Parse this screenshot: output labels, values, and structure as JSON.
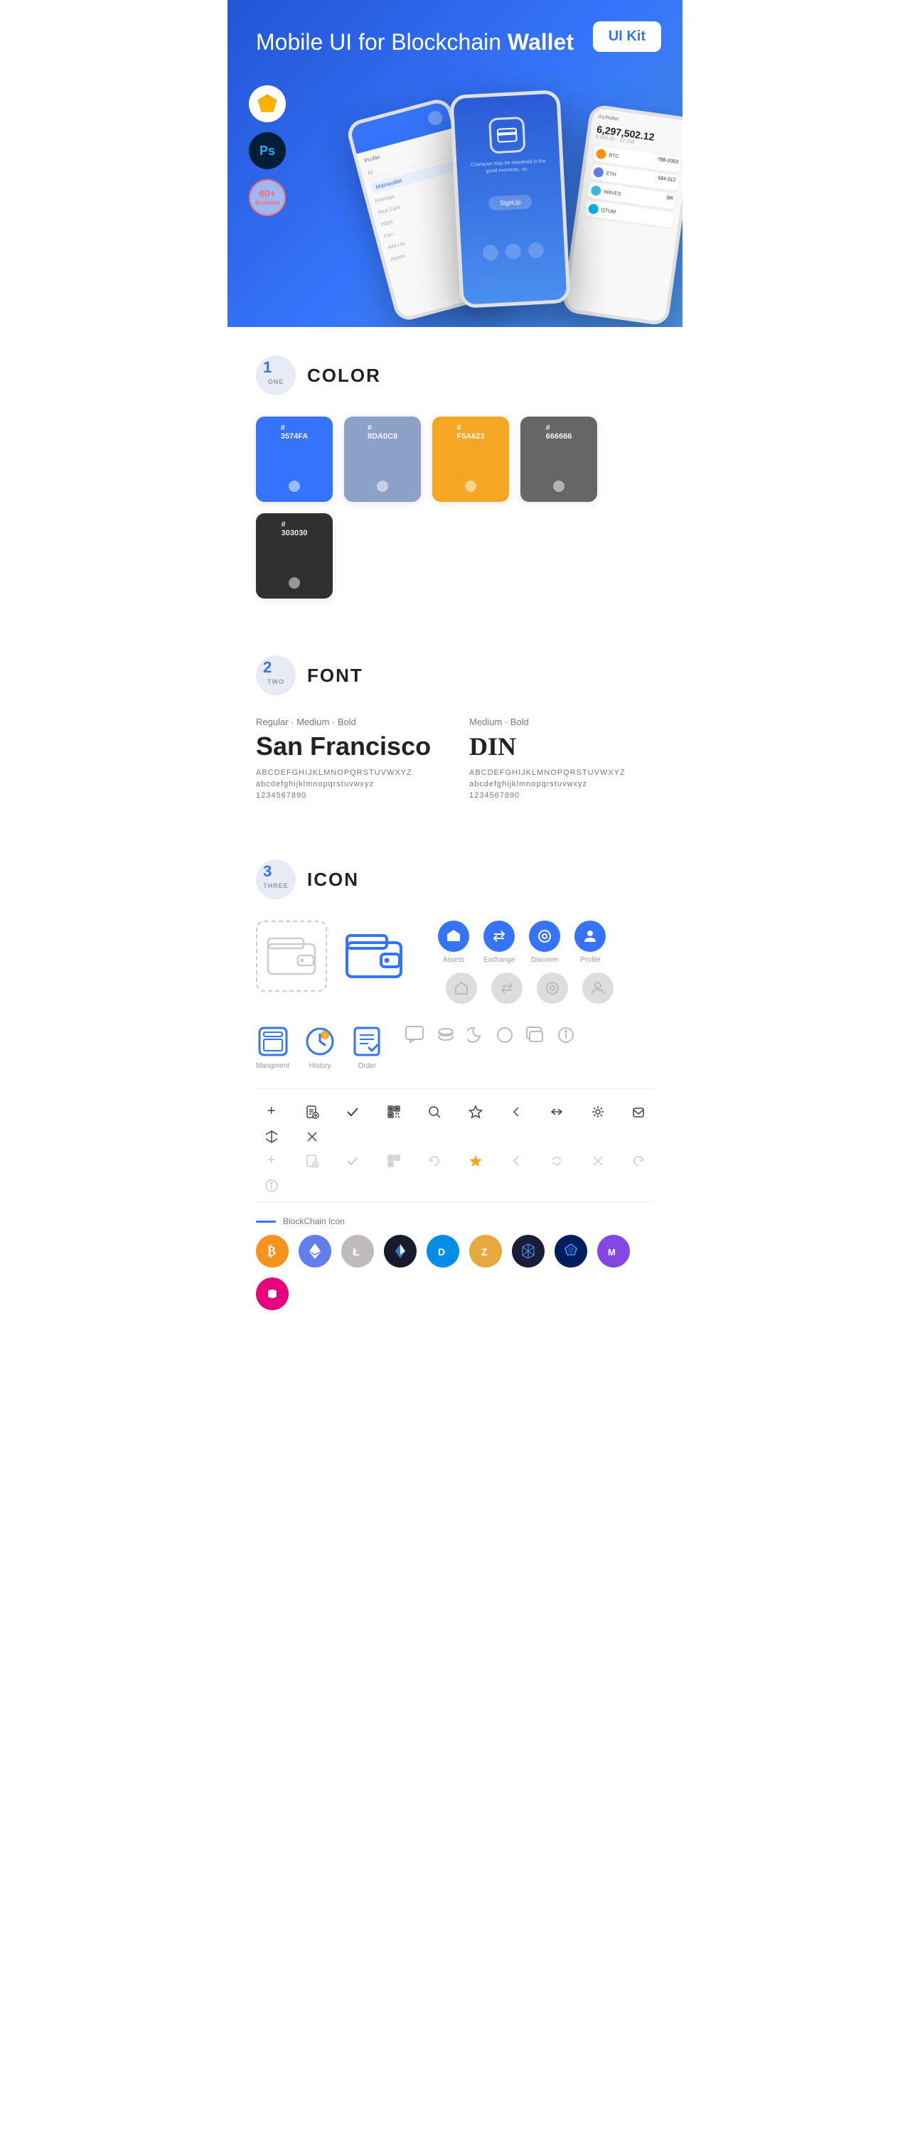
{
  "header": {
    "title_normal": "Mobile UI for Blockchain ",
    "title_bold": "Wallet",
    "badge": "UI Kit",
    "badges": [
      {
        "label": "Sketch",
        "type": "sketch"
      },
      {
        "label": "Ps",
        "type": "ps"
      },
      {
        "label": "60+\nScreens",
        "type": "screens"
      }
    ]
  },
  "sections": {
    "color": {
      "num": "1",
      "num_label": "ONE",
      "title": "COLOR",
      "swatches": [
        {
          "hex": "#3574FA",
          "code": "#\n3574FA",
          "bg": "#3574FA"
        },
        {
          "hex": "#8DA0C8",
          "code": "#\n8DA0C8",
          "bg": "#8DA0C8"
        },
        {
          "hex": "#F5A623",
          "code": "#\nF5A623",
          "bg": "#F5A623"
        },
        {
          "hex": "#666666",
          "code": "#\n666666",
          "bg": "#666666"
        },
        {
          "hex": "#303030",
          "code": "#\n303030",
          "bg": "#303030"
        }
      ]
    },
    "font": {
      "num": "2",
      "num_label": "TWO",
      "title": "FONT",
      "fonts": [
        {
          "style": "Regular · Medium · Bold",
          "name": "San Francisco",
          "abc_upper": "ABCDEFGHIJKLMNOPQRSTUVWXYZ",
          "abc_lower": "abcdefghijklmnopqrstuvwxyz",
          "nums": "1234567890"
        },
        {
          "style": "Medium · Bold",
          "name": "DIN",
          "abc_upper": "ABCDEFGHIJKLMNOPQRSTUVWXYZ",
          "abc_lower": "abcdefghijklmnopqrstuvwxyz",
          "nums": "1234567890"
        }
      ]
    },
    "icon": {
      "num": "3",
      "num_label": "THREE",
      "title": "ICON",
      "nav_labels": [
        "Assets",
        "Exchange",
        "Discover",
        "Profile"
      ],
      "mgmt_labels": [
        "Mangment",
        "History",
        "Order"
      ],
      "blockchain_label": "BlockChain Icon",
      "coins": [
        "BTC",
        "ETH",
        "LTC",
        "WINGS",
        "DASH",
        "ZEN",
        "QRL",
        "GNT",
        "MATIC",
        "DP"
      ]
    }
  }
}
